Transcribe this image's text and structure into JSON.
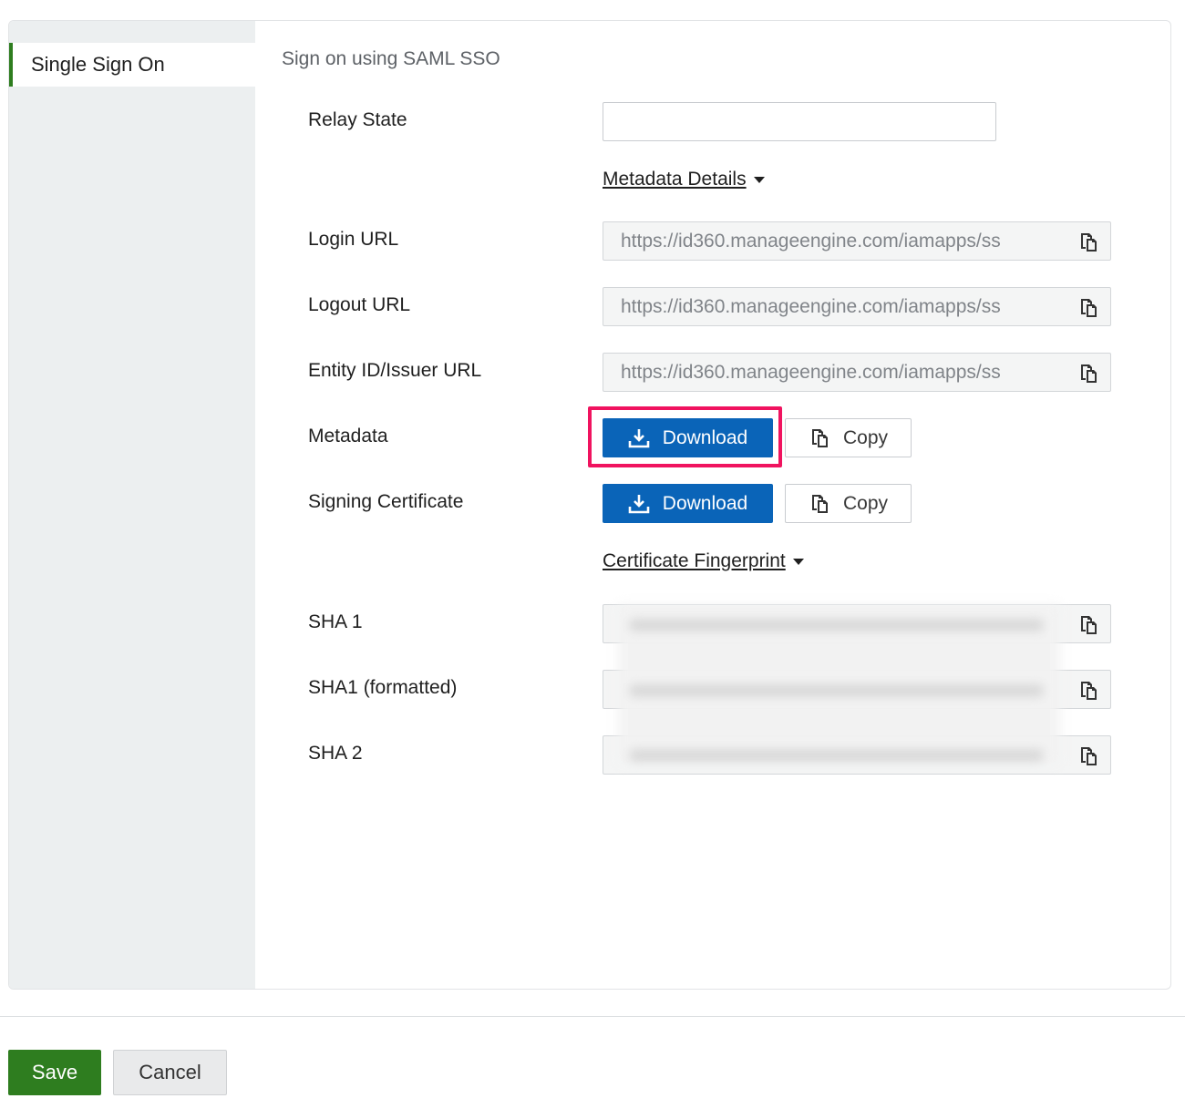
{
  "sidebar": {
    "items": [
      {
        "label": "Single Sign On",
        "active": true
      }
    ]
  },
  "main": {
    "section_title": "Sign on using SAML SSO",
    "relay_state": {
      "label": "Relay State",
      "value": ""
    },
    "metadata_details_toggle": "Metadata Details",
    "login_url": {
      "label": "Login URL",
      "value": "https://id360.manageengine.com/iamapps/ss"
    },
    "logout_url": {
      "label": "Logout URL",
      "value": "https://id360.manageengine.com/iamapps/ss"
    },
    "entity_id": {
      "label": "Entity ID/Issuer URL",
      "value": "https://id360.manageengine.com/iamapps/ss"
    },
    "metadata": {
      "label": "Metadata",
      "download_label": "Download",
      "copy_label": "Copy"
    },
    "signing_certificate": {
      "label": "Signing Certificate",
      "download_label": "Download",
      "copy_label": "Copy"
    },
    "certificate_fingerprint_toggle": "Certificate Fingerprint",
    "sha1": {
      "label": "SHA 1"
    },
    "sha1_formatted": {
      "label": "SHA1 (formatted)"
    },
    "sha2": {
      "label": "SHA 2"
    }
  },
  "footer": {
    "save_label": "Save",
    "cancel_label": "Cancel"
  },
  "colors": {
    "primary_blue": "#0a64b8",
    "save_green": "#2e7d1f",
    "highlight": "#f0135f",
    "sidebar_bg": "#eceff0"
  },
  "icons": {
    "copy": "copy-icon",
    "download": "download-icon",
    "caret": "caret-down-icon"
  }
}
